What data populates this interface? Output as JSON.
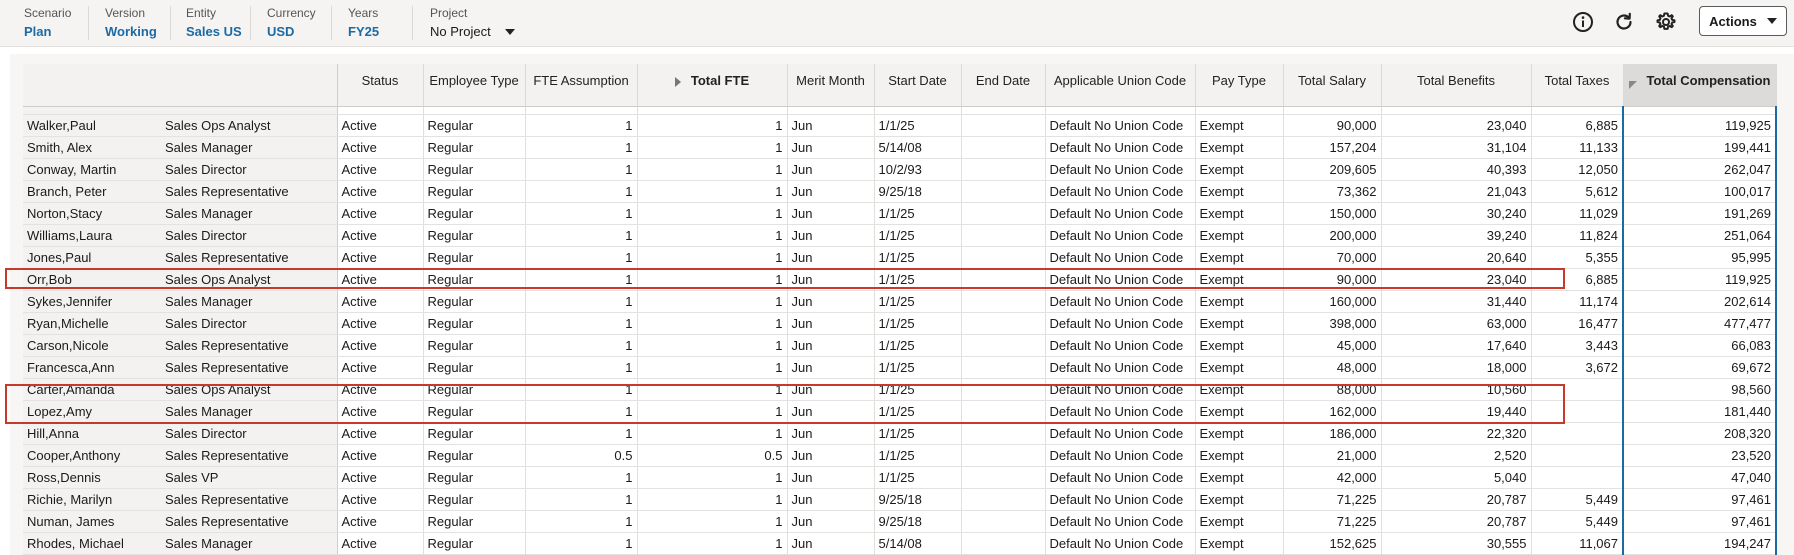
{
  "pov": {
    "scenario": {
      "label": "Scenario",
      "value": "Plan"
    },
    "version": {
      "label": "Version",
      "value": "Working"
    },
    "entity": {
      "label": "Entity",
      "value": "Sales US"
    },
    "currency": {
      "label": "Currency",
      "value": "USD"
    },
    "years": {
      "label": "Years",
      "value": "FY25"
    },
    "project": {
      "label": "Project",
      "value": "No Project"
    }
  },
  "toolbar": {
    "info_icon": "info-icon",
    "refresh_icon": "refresh-icon",
    "settings_icon": "gear-icon",
    "actions_label": "Actions"
  },
  "colors": {
    "accent": "#1b6aa5",
    "highlight": "#c8392b"
  },
  "grid": {
    "columns": [
      "",
      "",
      "Status",
      "Employee Type",
      "FTE Assumption",
      "Total FTE",
      "Merit Month",
      "Start Date",
      "End Date",
      "Applicable Union Code",
      "Pay Type",
      "Total Salary",
      "Total Benefits",
      "Total Taxes",
      "Total Compensation"
    ],
    "rows": [
      [
        "Walker,Paul",
        "Sales Ops Analyst",
        "Active",
        "Regular",
        "1",
        "1",
        "Jun",
        "1/1/25",
        "",
        "Default No Union Code",
        "Exempt",
        "90,000",
        "23,040",
        "6,885",
        "119,925"
      ],
      [
        "Smith, Alex",
        "Sales Manager",
        "Active",
        "Regular",
        "1",
        "1",
        "Jun",
        "5/14/08",
        "",
        "Default No Union Code",
        "Exempt",
        "157,204",
        "31,104",
        "11,133",
        "199,441"
      ],
      [
        "Conway, Martin",
        "Sales Director",
        "Active",
        "Regular",
        "1",
        "1",
        "Jun",
        "10/2/93",
        "",
        "Default No Union Code",
        "Exempt",
        "209,605",
        "40,393",
        "12,050",
        "262,047"
      ],
      [
        "Branch, Peter",
        "Sales Representative",
        "Active",
        "Regular",
        "1",
        "1",
        "Jun",
        "9/25/18",
        "",
        "Default No Union Code",
        "Exempt",
        "73,362",
        "21,043",
        "5,612",
        "100,017"
      ],
      [
        "Norton,Stacy",
        "Sales Manager",
        "Active",
        "Regular",
        "1",
        "1",
        "Jun",
        "1/1/25",
        "",
        "Default No Union Code",
        "Exempt",
        "150,000",
        "30,240",
        "11,029",
        "191,269"
      ],
      [
        "Williams,Laura",
        "Sales Director",
        "Active",
        "Regular",
        "1",
        "1",
        "Jun",
        "1/1/25",
        "",
        "Default No Union Code",
        "Exempt",
        "200,000",
        "39,240",
        "11,824",
        "251,064"
      ],
      [
        "Jones,Paul",
        "Sales Representative",
        "Active",
        "Regular",
        "1",
        "1",
        "Jun",
        "1/1/25",
        "",
        "Default No Union Code",
        "Exempt",
        "70,000",
        "20,640",
        "5,355",
        "95,995"
      ],
      [
        "Orr,Bob",
        "Sales Ops Analyst",
        "Active",
        "Regular",
        "1",
        "1",
        "Jun",
        "1/1/25",
        "",
        "Default No Union Code",
        "Exempt",
        "90,000",
        "23,040",
        "6,885",
        "119,925"
      ],
      [
        "Sykes,Jennifer",
        "Sales Manager",
        "Active",
        "Regular",
        "1",
        "1",
        "Jun",
        "1/1/25",
        "",
        "Default No Union Code",
        "Exempt",
        "160,000",
        "31,440",
        "11,174",
        "202,614"
      ],
      [
        "Ryan,Michelle",
        "Sales Director",
        "Active",
        "Regular",
        "1",
        "1",
        "Jun",
        "1/1/25",
        "",
        "Default No Union Code",
        "Exempt",
        "398,000",
        "63,000",
        "16,477",
        "477,477"
      ],
      [
        "Carson,Nicole",
        "Sales Representative",
        "Active",
        "Regular",
        "1",
        "1",
        "Jun",
        "1/1/25",
        "",
        "Default No Union Code",
        "Exempt",
        "45,000",
        "17,640",
        "3,443",
        "66,083"
      ],
      [
        "Francesca,Ann",
        "Sales Representative",
        "Active",
        "Regular",
        "1",
        "1",
        "Jun",
        "1/1/25",
        "",
        "Default No Union Code",
        "Exempt",
        "48,000",
        "18,000",
        "3,672",
        "69,672"
      ],
      [
        "Carter,Amanda",
        "Sales Ops Analyst",
        "Active",
        "Regular",
        "1",
        "1",
        "Jun",
        "1/1/25",
        "",
        "Default No Union Code",
        "Exempt",
        "88,000",
        "10,560",
        "",
        "98,560"
      ],
      [
        "Lopez,Amy",
        "Sales Manager",
        "Active",
        "Regular",
        "1",
        "1",
        "Jun",
        "1/1/25",
        "",
        "Default No Union Code",
        "Exempt",
        "162,000",
        "19,440",
        "",
        "181,440"
      ],
      [
        "Hill,Anna",
        "Sales Director",
        "Active",
        "Regular",
        "1",
        "1",
        "Jun",
        "1/1/25",
        "",
        "Default No Union Code",
        "Exempt",
        "186,000",
        "22,320",
        "",
        "208,320"
      ],
      [
        "Cooper,Anthony",
        "Sales Representative",
        "Active",
        "Regular",
        "0.5",
        "0.5",
        "Jun",
        "1/1/25",
        "",
        "Default No Union Code",
        "Exempt",
        "21,000",
        "2,520",
        "",
        "23,520"
      ],
      [
        "Ross,Dennis",
        "Sales VP",
        "Active",
        "Regular",
        "1",
        "1",
        "Jun",
        "1/1/25",
        "",
        "Default No Union Code",
        "Exempt",
        "42,000",
        "5,040",
        "",
        "47,040"
      ],
      [
        "Richie, Marilyn",
        "Sales Representative",
        "Active",
        "Regular",
        "1",
        "1",
        "Jun",
        "9/25/18",
        "",
        "Default No Union Code",
        "Exempt",
        "71,225",
        "20,787",
        "5,449",
        "97,461"
      ],
      [
        "Numan, James",
        "Sales Representative",
        "Active",
        "Regular",
        "1",
        "1",
        "Jun",
        "9/25/18",
        "",
        "Default No Union Code",
        "Exempt",
        "71,225",
        "20,787",
        "5,449",
        "97,461"
      ],
      [
        "Rhodes, Michael",
        "Sales Manager",
        "Active",
        "Regular",
        "1",
        "1",
        "Jun",
        "5/14/08",
        "",
        "Default No Union Code",
        "Exempt",
        "152,625",
        "30,555",
        "11,067",
        "194,247"
      ]
    ]
  }
}
